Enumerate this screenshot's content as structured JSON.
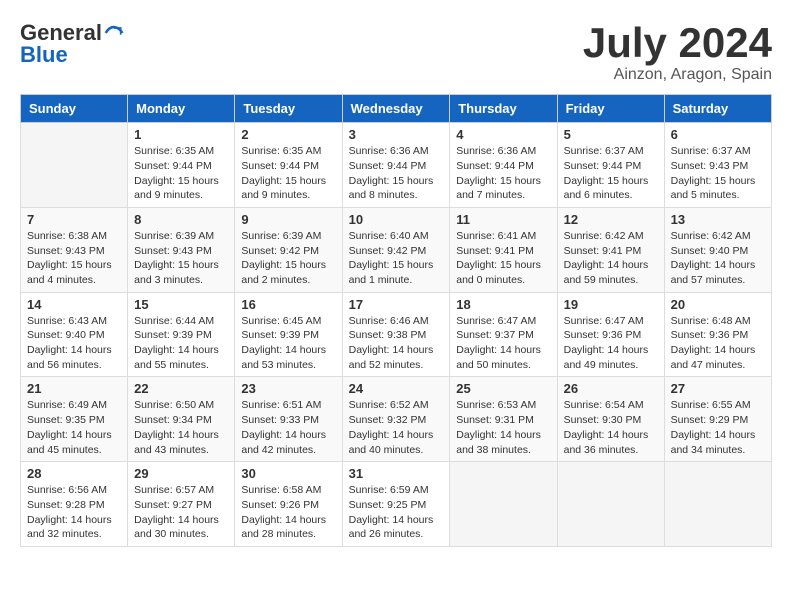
{
  "logo": {
    "general": "General",
    "blue": "Blue"
  },
  "title": {
    "month_year": "July 2024",
    "location": "Ainzon, Aragon, Spain"
  },
  "calendar": {
    "headers": [
      "Sunday",
      "Monday",
      "Tuesday",
      "Wednesday",
      "Thursday",
      "Friday",
      "Saturday"
    ],
    "rows": [
      [
        {
          "day": "",
          "sunrise": "",
          "sunset": "",
          "daylight": "",
          "empty": true
        },
        {
          "day": "1",
          "sunrise": "Sunrise: 6:35 AM",
          "sunset": "Sunset: 9:44 PM",
          "daylight": "Daylight: 15 hours and 9 minutes."
        },
        {
          "day": "2",
          "sunrise": "Sunrise: 6:35 AM",
          "sunset": "Sunset: 9:44 PM",
          "daylight": "Daylight: 15 hours and 9 minutes."
        },
        {
          "day": "3",
          "sunrise": "Sunrise: 6:36 AM",
          "sunset": "Sunset: 9:44 PM",
          "daylight": "Daylight: 15 hours and 8 minutes."
        },
        {
          "day": "4",
          "sunrise": "Sunrise: 6:36 AM",
          "sunset": "Sunset: 9:44 PM",
          "daylight": "Daylight: 15 hours and 7 minutes."
        },
        {
          "day": "5",
          "sunrise": "Sunrise: 6:37 AM",
          "sunset": "Sunset: 9:44 PM",
          "daylight": "Daylight: 15 hours and 6 minutes."
        },
        {
          "day": "6",
          "sunrise": "Sunrise: 6:37 AM",
          "sunset": "Sunset: 9:43 PM",
          "daylight": "Daylight: 15 hours and 5 minutes."
        }
      ],
      [
        {
          "day": "7",
          "sunrise": "Sunrise: 6:38 AM",
          "sunset": "Sunset: 9:43 PM",
          "daylight": "Daylight: 15 hours and 4 minutes."
        },
        {
          "day": "8",
          "sunrise": "Sunrise: 6:39 AM",
          "sunset": "Sunset: 9:43 PM",
          "daylight": "Daylight: 15 hours and 3 minutes."
        },
        {
          "day": "9",
          "sunrise": "Sunrise: 6:39 AM",
          "sunset": "Sunset: 9:42 PM",
          "daylight": "Daylight: 15 hours and 2 minutes."
        },
        {
          "day": "10",
          "sunrise": "Sunrise: 6:40 AM",
          "sunset": "Sunset: 9:42 PM",
          "daylight": "Daylight: 15 hours and 1 minute."
        },
        {
          "day": "11",
          "sunrise": "Sunrise: 6:41 AM",
          "sunset": "Sunset: 9:41 PM",
          "daylight": "Daylight: 15 hours and 0 minutes."
        },
        {
          "day": "12",
          "sunrise": "Sunrise: 6:42 AM",
          "sunset": "Sunset: 9:41 PM",
          "daylight": "Daylight: 14 hours and 59 minutes."
        },
        {
          "day": "13",
          "sunrise": "Sunrise: 6:42 AM",
          "sunset": "Sunset: 9:40 PM",
          "daylight": "Daylight: 14 hours and 57 minutes."
        }
      ],
      [
        {
          "day": "14",
          "sunrise": "Sunrise: 6:43 AM",
          "sunset": "Sunset: 9:40 PM",
          "daylight": "Daylight: 14 hours and 56 minutes."
        },
        {
          "day": "15",
          "sunrise": "Sunrise: 6:44 AM",
          "sunset": "Sunset: 9:39 PM",
          "daylight": "Daylight: 14 hours and 55 minutes."
        },
        {
          "day": "16",
          "sunrise": "Sunrise: 6:45 AM",
          "sunset": "Sunset: 9:39 PM",
          "daylight": "Daylight: 14 hours and 53 minutes."
        },
        {
          "day": "17",
          "sunrise": "Sunrise: 6:46 AM",
          "sunset": "Sunset: 9:38 PM",
          "daylight": "Daylight: 14 hours and 52 minutes."
        },
        {
          "day": "18",
          "sunrise": "Sunrise: 6:47 AM",
          "sunset": "Sunset: 9:37 PM",
          "daylight": "Daylight: 14 hours and 50 minutes."
        },
        {
          "day": "19",
          "sunrise": "Sunrise: 6:47 AM",
          "sunset": "Sunset: 9:36 PM",
          "daylight": "Daylight: 14 hours and 49 minutes."
        },
        {
          "day": "20",
          "sunrise": "Sunrise: 6:48 AM",
          "sunset": "Sunset: 9:36 PM",
          "daylight": "Daylight: 14 hours and 47 minutes."
        }
      ],
      [
        {
          "day": "21",
          "sunrise": "Sunrise: 6:49 AM",
          "sunset": "Sunset: 9:35 PM",
          "daylight": "Daylight: 14 hours and 45 minutes."
        },
        {
          "day": "22",
          "sunrise": "Sunrise: 6:50 AM",
          "sunset": "Sunset: 9:34 PM",
          "daylight": "Daylight: 14 hours and 43 minutes."
        },
        {
          "day": "23",
          "sunrise": "Sunrise: 6:51 AM",
          "sunset": "Sunset: 9:33 PM",
          "daylight": "Daylight: 14 hours and 42 minutes."
        },
        {
          "day": "24",
          "sunrise": "Sunrise: 6:52 AM",
          "sunset": "Sunset: 9:32 PM",
          "daylight": "Daylight: 14 hours and 40 minutes."
        },
        {
          "day": "25",
          "sunrise": "Sunrise: 6:53 AM",
          "sunset": "Sunset: 9:31 PM",
          "daylight": "Daylight: 14 hours and 38 minutes."
        },
        {
          "day": "26",
          "sunrise": "Sunrise: 6:54 AM",
          "sunset": "Sunset: 9:30 PM",
          "daylight": "Daylight: 14 hours and 36 minutes."
        },
        {
          "day": "27",
          "sunrise": "Sunrise: 6:55 AM",
          "sunset": "Sunset: 9:29 PM",
          "daylight": "Daylight: 14 hours and 34 minutes."
        }
      ],
      [
        {
          "day": "28",
          "sunrise": "Sunrise: 6:56 AM",
          "sunset": "Sunset: 9:28 PM",
          "daylight": "Daylight: 14 hours and 32 minutes."
        },
        {
          "day": "29",
          "sunrise": "Sunrise: 6:57 AM",
          "sunset": "Sunset: 9:27 PM",
          "daylight": "Daylight: 14 hours and 30 minutes."
        },
        {
          "day": "30",
          "sunrise": "Sunrise: 6:58 AM",
          "sunset": "Sunset: 9:26 PM",
          "daylight": "Daylight: 14 hours and 28 minutes."
        },
        {
          "day": "31",
          "sunrise": "Sunrise: 6:59 AM",
          "sunset": "Sunset: 9:25 PM",
          "daylight": "Daylight: 14 hours and 26 minutes."
        },
        {
          "day": "",
          "sunrise": "",
          "sunset": "",
          "daylight": "",
          "empty": true
        },
        {
          "day": "",
          "sunrise": "",
          "sunset": "",
          "daylight": "",
          "empty": true
        },
        {
          "day": "",
          "sunrise": "",
          "sunset": "",
          "daylight": "",
          "empty": true
        }
      ]
    ]
  }
}
